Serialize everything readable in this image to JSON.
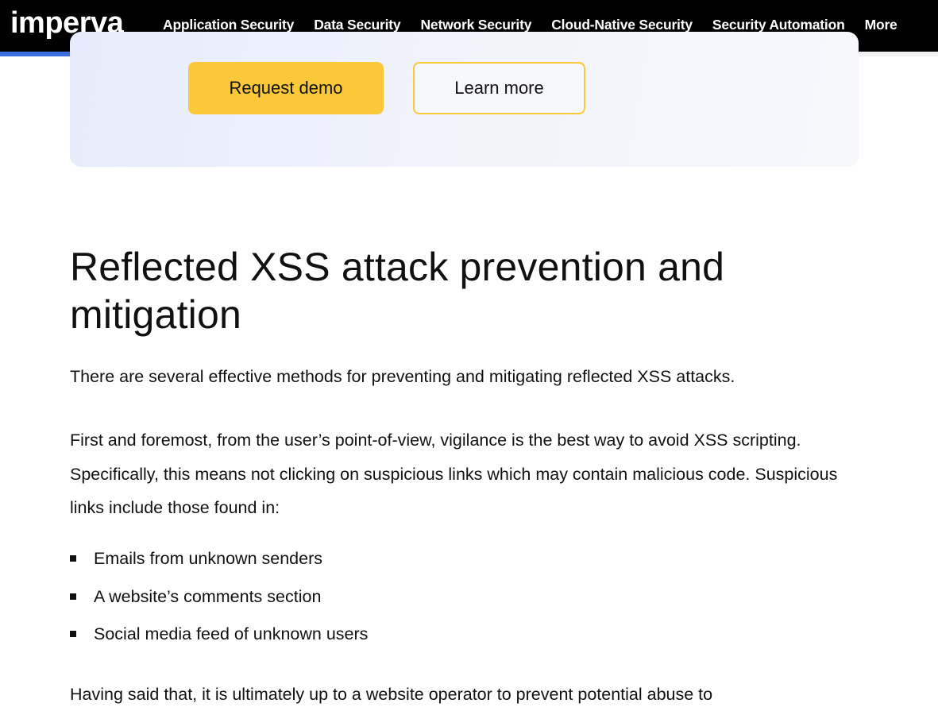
{
  "nav": {
    "logo": "imperva",
    "items": [
      "Application Security",
      "Data Security",
      "Network Security",
      "Cloud-Native Security",
      "Security Automation",
      "More"
    ],
    "scroll_progress": 0.83,
    "colors": {
      "background": "#000000",
      "progress": "#3b6fe0",
      "progress_cap": "#5fd3a8"
    }
  },
  "cta": {
    "request_demo": "Request demo",
    "learn_more": "Learn more",
    "colors": {
      "primary": "#fbc83a"
    }
  },
  "article": {
    "heading": "Reflected XSS attack prevention and mitigation",
    "intro": "There are several effective methods for preventing and mitigating reflected XSS attacks.",
    "paragraph": "First and foremost, from the user’s point-of-view, vigilance is the best way to avoid XSS scripting. Specifically, this means not clicking on suspicious links which may contain malicious code. Suspicious links include those found in:",
    "bullets": [
      "Emails from unknown senders",
      "A website’s comments section",
      "Social media feed of unknown users"
    ],
    "next_paragraph": "Having said that, it is ultimately up to a website operator to prevent potential abuse to"
  }
}
